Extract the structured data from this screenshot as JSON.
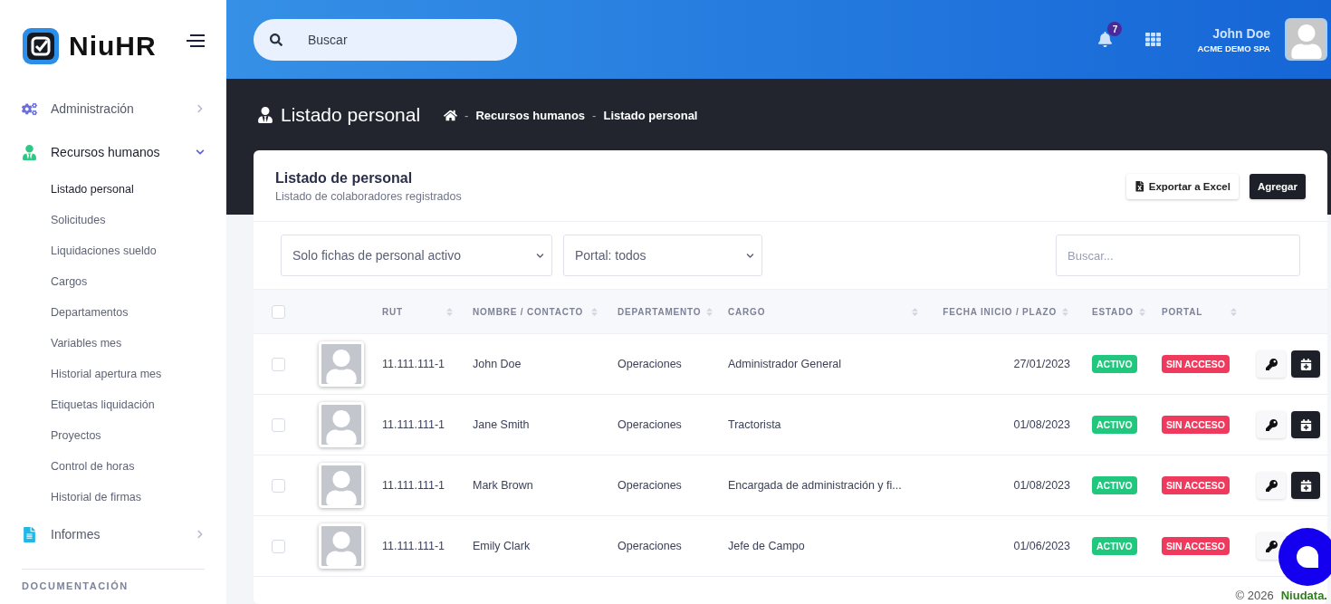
{
  "brand": {
    "name": "NiuHR"
  },
  "sidebar": {
    "items": [
      {
        "label": "Administración",
        "kind": "cogs",
        "expanded": false
      },
      {
        "label": "Recursos humanos",
        "kind": "person",
        "expanded": true,
        "children": [
          {
            "label": "Listado personal",
            "selected": true
          },
          {
            "label": "Solicitudes",
            "selected": false
          },
          {
            "label": "Liquidaciones sueldo",
            "selected": false
          },
          {
            "label": "Cargos",
            "selected": false
          },
          {
            "label": "Departamentos",
            "selected": false
          },
          {
            "label": "Variables mes",
            "selected": false
          },
          {
            "label": "Historial apertura mes",
            "selected": false
          },
          {
            "label": "Etiquetas liquidación",
            "selected": false
          },
          {
            "label": "Proyectos",
            "selected": false
          },
          {
            "label": "Control de horas",
            "selected": false
          },
          {
            "label": "Historial de firmas",
            "selected": false
          }
        ]
      },
      {
        "label": "Informes",
        "kind": "file",
        "expanded": false
      }
    ],
    "section_heading": "DOCUMENTACIÓN"
  },
  "topbar": {
    "search": {
      "placeholder": "Buscar"
    },
    "notifications": "7",
    "user": {
      "name": "John Doe",
      "company": "ACME DEMO SPA"
    }
  },
  "page_header": {
    "title": "Listado personal",
    "breadcrumb": [
      {
        "separator": "-",
        "label": "Recursos humanos"
      },
      {
        "separator": "-",
        "label": "Listado personal"
      }
    ]
  },
  "card": {
    "title": "Listado de personal",
    "subtitle": "Listado de colaboradores registrados",
    "buttons": [
      {
        "label": "Exportar a Excel",
        "kind": "export"
      },
      {
        "label": "Agregar",
        "kind": "primary"
      }
    ],
    "filters": [
      {
        "value": "Solo fichas de personal activo"
      },
      {
        "value": "Portal: todos"
      }
    ],
    "search": {
      "placeholder": "Buscar..."
    }
  },
  "table": {
    "columns": [
      {
        "label": "RUT"
      },
      {
        "label": "NOMBRE / CONTACTO"
      },
      {
        "label": "DEPARTAMENTO"
      },
      {
        "label": "CARGO"
      },
      {
        "label": "FECHA INICIO / PLAZO"
      },
      {
        "label": "ESTADO"
      },
      {
        "label": "PORTAL"
      }
    ],
    "header_checked": false,
    "rows": [
      {
        "checked": false,
        "rut": "11.111.111-1",
        "name": "John Doe",
        "department": "Operaciones",
        "cargo": "Administrador General",
        "fecha": "27/01/2023",
        "estado": {
          "label": "ACTIVO",
          "color": "#22c77e"
        },
        "portal": {
          "label": "SIN ACCESO",
          "color": "#ef3a5d"
        }
      },
      {
        "checked": false,
        "rut": "11.111.111-1",
        "name": "Jane Smith",
        "department": "Operaciones",
        "cargo": "Tractorista",
        "fecha": "01/08/2023",
        "estado": {
          "label": "ACTIVO",
          "color": "#22c77e"
        },
        "portal": {
          "label": "SIN ACCESO",
          "color": "#ef3a5d"
        }
      },
      {
        "checked": false,
        "rut": "11.111.111-1",
        "name": "Mark Brown",
        "department": "Operaciones",
        "cargo": "Encargada de administración y fi...",
        "fecha": "01/08/2023",
        "estado": {
          "label": "ACTIVO",
          "color": "#22c77e"
        },
        "portal": {
          "label": "SIN ACCESO",
          "color": "#ef3a5d"
        }
      },
      {
        "checked": false,
        "rut": "11.111.111-1",
        "name": "Emily Clark",
        "department": "Operaciones",
        "cargo": "Jefe de Campo",
        "fecha": "01/06/2023",
        "estado": {
          "label": "ACTIVO",
          "color": "#22c77e"
        },
        "portal": {
          "label": "SIN ACCESO",
          "color": "#ef3a5d"
        }
      }
    ]
  },
  "footer": {
    "copyright": "© 2026",
    "company": "Niudata."
  }
}
